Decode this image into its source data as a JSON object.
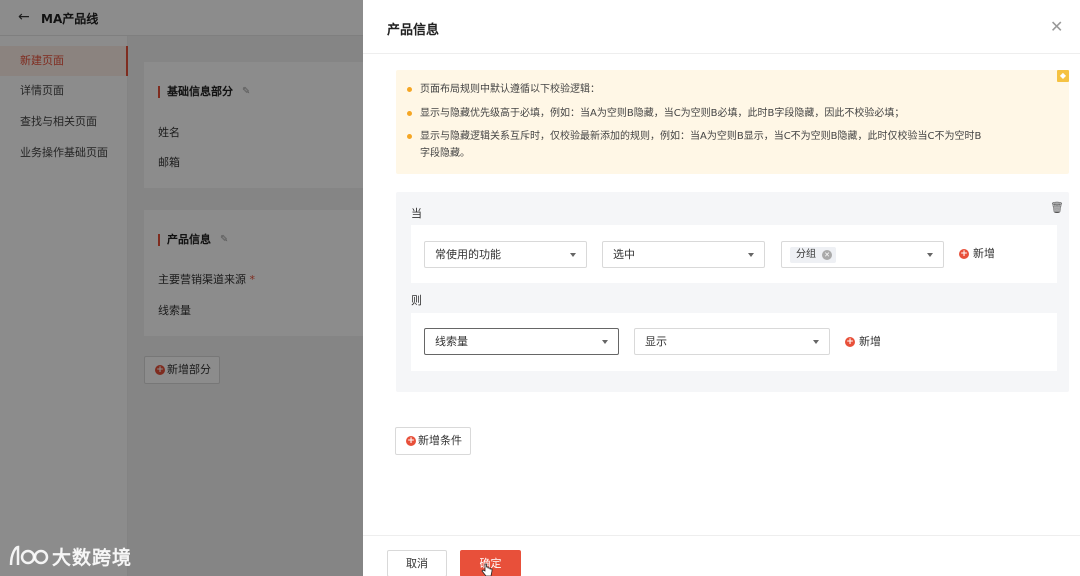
{
  "app": {
    "back_icon": "arrow-left-icon",
    "title": "MA产品线"
  },
  "sidebar": {
    "items": [
      {
        "label": "新建页面",
        "active": true
      },
      {
        "label": "详情页面",
        "active": false
      },
      {
        "label": "查找与相关页面",
        "active": false
      },
      {
        "label": "业务操作基础页面",
        "active": false
      }
    ]
  },
  "background": {
    "sections": [
      {
        "title": "基础信息部分",
        "fields": [
          "姓名",
          "邮箱"
        ]
      },
      {
        "title": "产品信息",
        "fields": [
          "主要营销渠道来源",
          "线索量"
        ],
        "required_mark": "*"
      }
    ],
    "add_section_label": "新增部分"
  },
  "watermark": {
    "text": "大数跨境"
  },
  "drawer": {
    "title": "产品信息",
    "notice": [
      "页面布局规则中默认遵循以下校验逻辑：",
      "显示与隐藏优先级高于必填，例如：当A为空则B隐藏，当C为空则B必填，此时B字段隐藏，因此不校验必填；",
      "显示与隐藏逻辑关系互斥时，仅校验最新添加的规则，例如：当A为空则B显示，当C不为空则B隐藏，此时仅校验当C不为空时B",
      "字段隐藏。"
    ],
    "rule": {
      "when_label": "当",
      "then_label": "则",
      "condition": {
        "field": "常使用的功能",
        "operator": "选中",
        "value_tag": "分组",
        "add_label": "新增"
      },
      "action": {
        "field": "线索量",
        "effect": "显示",
        "add_label": "新增"
      }
    },
    "add_condition_label": "新增条件",
    "footer": {
      "cancel_label": "取消",
      "confirm_label": "确定"
    }
  },
  "colors": {
    "accent": "#e8503a",
    "notice_bg": "#fff7e6",
    "panel_bg": "#f5f6f8"
  }
}
